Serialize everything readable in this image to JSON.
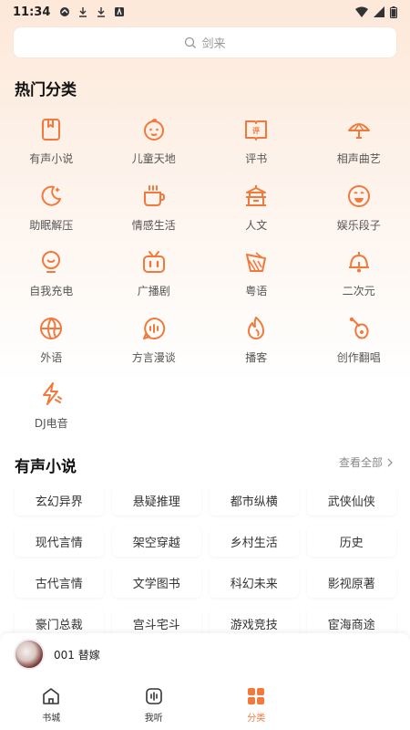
{
  "status_bar": {
    "time": "11:34"
  },
  "search": {
    "placeholder": "剑来"
  },
  "hot": {
    "title": "热门分类",
    "items": [
      {
        "label": "有声小说",
        "icon": "book-icon"
      },
      {
        "label": "儿童天地",
        "icon": "child-face-icon"
      },
      {
        "label": "评书",
        "icon": "storytelling-book-icon"
      },
      {
        "label": "相声曲艺",
        "icon": "fan-icon"
      },
      {
        "label": "助眠解压",
        "icon": "moon-icon"
      },
      {
        "label": "情感生活",
        "icon": "cup-icon"
      },
      {
        "label": "人文",
        "icon": "pavilion-icon"
      },
      {
        "label": "娱乐段子",
        "icon": "laugh-face-icon"
      },
      {
        "label": "自我充电",
        "icon": "bulb-icon"
      },
      {
        "label": "广播剧",
        "icon": "tv-icon"
      },
      {
        "label": "粤语",
        "icon": "tea-icon"
      },
      {
        "label": "二次元",
        "icon": "bell-icon"
      },
      {
        "label": "外语",
        "icon": "globe-icon"
      },
      {
        "label": "方言漫谈",
        "icon": "voice-bubble-icon"
      },
      {
        "label": "播客",
        "icon": "flame-icon"
      },
      {
        "label": "创作翻唱",
        "icon": "guitar-icon"
      },
      {
        "label": "DJ电音",
        "icon": "lightning-icon"
      }
    ]
  },
  "novel": {
    "title": "有声小说",
    "view_all": "查看全部",
    "tags": [
      "玄幻异界",
      "悬疑推理",
      "都市纵横",
      "武侠仙侠",
      "现代言情",
      "架空穿越",
      "乡村生活",
      "历史",
      "古代言情",
      "文学图书",
      "科幻未来",
      "影视原著",
      "豪门总裁",
      "宫斗宅斗",
      "游戏竞技",
      "宦海商途"
    ]
  },
  "player": {
    "title": "001 替嫁"
  },
  "tabs": [
    {
      "label": "书城",
      "icon": "home-icon"
    },
    {
      "label": "我听",
      "icon": "listen-icon"
    },
    {
      "label": "分类",
      "icon": "category-grid-icon",
      "active": true
    }
  ],
  "colors": {
    "accent": "#f2793c",
    "text": "#222222"
  }
}
